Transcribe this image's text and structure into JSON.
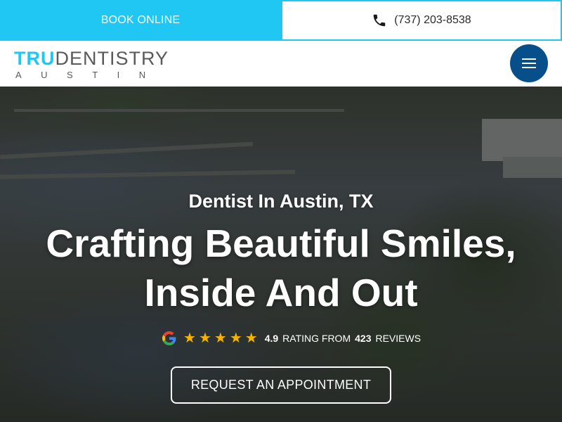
{
  "topbar": {
    "book_online": "BOOK ONLINE",
    "phone": "(737) 203-8538",
    "accent_color": "#1fc7f2"
  },
  "header": {
    "logo_tru": "TRU",
    "logo_dentistry": "DENTISTRY",
    "logo_sub": "AUSTIN",
    "menu_color": "#064f8b"
  },
  "hero": {
    "subtitle": "Dentist In Austin, TX",
    "title": "Crafting Beautiful Smiles, Inside And Out",
    "rating": {
      "stars": 5,
      "score": "4.9",
      "from_text": "RATING FROM",
      "count": "423",
      "reviews_text": "REVIEWS",
      "star_color": "#f5b301"
    },
    "cta_label": "REQUEST AN APPOINTMENT"
  },
  "icons": {
    "phone": "phone-icon",
    "menu": "hamburger-menu-icon",
    "google": "google-g-icon",
    "star": "star-icon"
  }
}
